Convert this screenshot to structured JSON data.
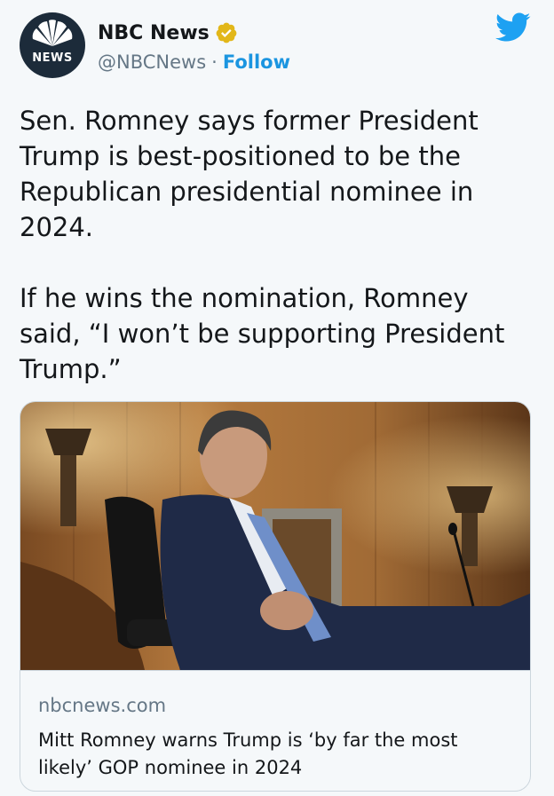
{
  "account": {
    "display_name": "NBC News",
    "handle": "@NBCNews",
    "separator": "·",
    "follow_label": "Follow",
    "avatar_text": "NEWS",
    "verified_color": "#e2b719"
  },
  "tweet": {
    "text": "Sen. Romney says former President Trump is best-positioned to be the Republican presidential nominee in 2024.\n\nIf he wins the nomination, Romney said, “I won’t be supporting President Trump.”"
  },
  "card": {
    "image_icon": "photo-senator-hearing-room",
    "domain": "nbcnews.com",
    "title": "Mitt Romney warns Trump is ‘by far the most likely’ GOP nominee in 2024"
  },
  "colors": {
    "link": "#1b95e0",
    "twitter_brand": "#1da1f2",
    "secondary_text": "#657786",
    "border": "#ccd6dd"
  }
}
